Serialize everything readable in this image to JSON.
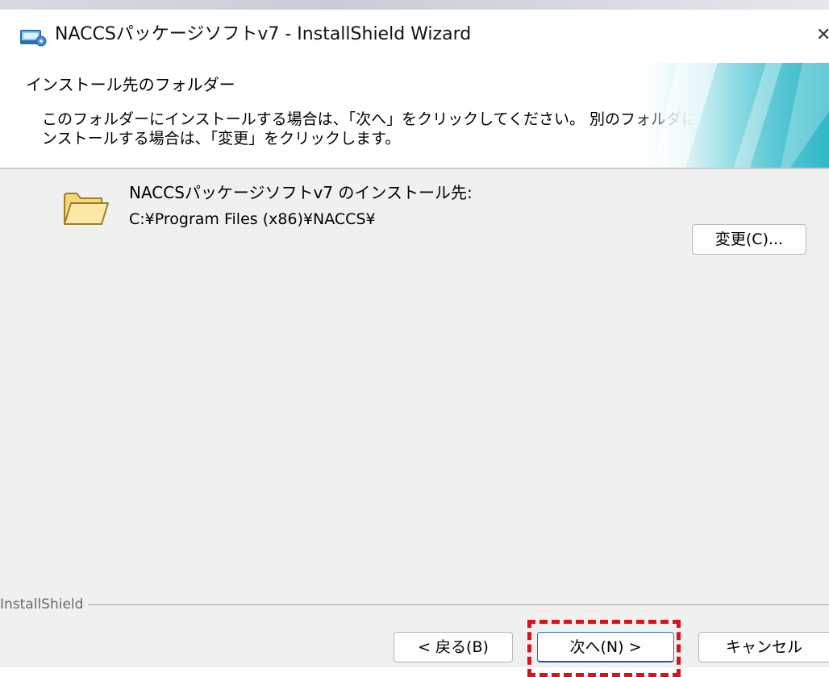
{
  "window": {
    "title": "NACCSパッケージソフトv7 - InstallShield Wizard"
  },
  "banner": {
    "heading": "インストール先のフォルダー",
    "description": "このフォルダーにインストールする場合は、「次へ」をクリックしてください。 別のフォルダにインストールする場合は、「変更」をクリックします。"
  },
  "destination": {
    "label": "NACCSパッケージソフトv7 のインストール先:",
    "path": "C:¥Program Files (x86)¥NACCS¥",
    "change_label": "変更(C)..."
  },
  "footer": {
    "group_label": "InstallShield",
    "back_label": "< 戻る(B)",
    "next_label": "次へ(N) >",
    "cancel_label": "キャンセル"
  },
  "icons": {
    "app": "installer-icon",
    "folder": "folder-icon",
    "close": "close-icon"
  },
  "colors": {
    "highlight": "#d7141a",
    "default_button_border": "#2b6fc2",
    "banner_accent": "#2fb8c8"
  }
}
